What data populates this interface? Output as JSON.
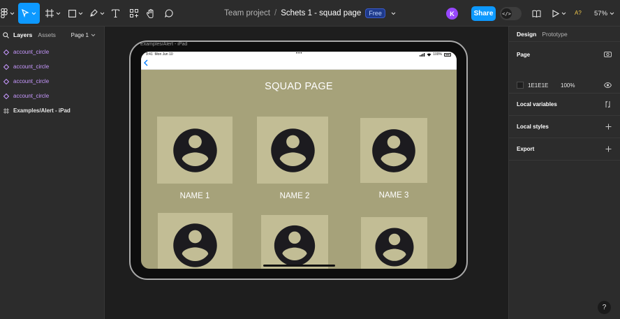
{
  "toolbar": {
    "title": {
      "team": "Team project",
      "separator": "/",
      "file": "Schets 1 - squad page",
      "badge": "Free"
    },
    "avatar_initial": "K",
    "share_label": "Share",
    "devmode_glyph": "</>",
    "ai_label": "A?",
    "zoom": "57%"
  },
  "left_panel": {
    "tabs": {
      "layers": "Layers",
      "assets": "Assets"
    },
    "page_selector": "Page 1",
    "layers": [
      {
        "label": "account_circle",
        "kind": "component"
      },
      {
        "label": "account_circle",
        "kind": "component"
      },
      {
        "label": "account_circle",
        "kind": "component"
      },
      {
        "label": "account_circle",
        "kind": "component"
      },
      {
        "label": "Examples/Alert - iPad",
        "kind": "frame"
      }
    ]
  },
  "right_panel": {
    "tabs": {
      "design": "Design",
      "prototype": "Prototype"
    },
    "page": {
      "heading": "Page",
      "color_hex": "1E1E1E",
      "opacity": "100%"
    },
    "sections": [
      "Local variables",
      "Local styles",
      "Export"
    ]
  },
  "canvas": {
    "frame_label": "Examples/Alert - iPad",
    "status_bar": {
      "time": "9:41",
      "date": "Mon Jun 10",
      "dots": "•••",
      "battery": "100%"
    },
    "page_title": "SQUAD PAGE",
    "members": [
      {
        "name": "NAME 1"
      },
      {
        "name": "NAME 2"
      },
      {
        "name": "NAME 3"
      },
      {
        "name": ""
      },
      {
        "name": ""
      },
      {
        "name": ""
      }
    ]
  },
  "colors": {
    "accent": "#0d99ff",
    "screen_bg": "#a6a27a",
    "card_bg": "#c2bd95",
    "icon": "#1c1b1f",
    "component": "#c798ff"
  },
  "help_label": "?"
}
